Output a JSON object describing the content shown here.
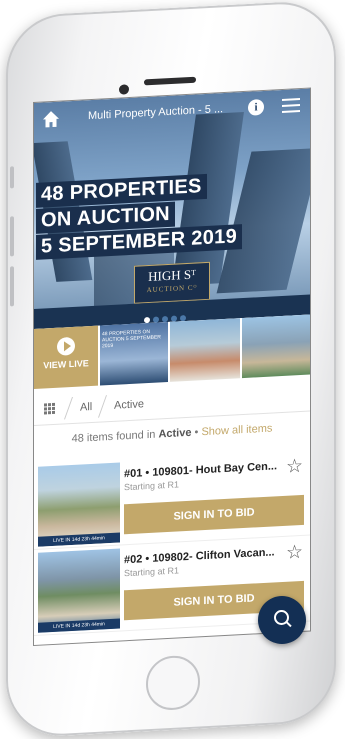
{
  "header": {
    "title": "Multi Property Auction - 5 ...",
    "info_icon": "i"
  },
  "hero": {
    "line1": "48 PROPERTIES",
    "line2": "ON AUCTION",
    "line3": "5 SEPTEMBER 2019",
    "logo_top": "THE",
    "logo_main": "HIGH Sᵀ",
    "logo_bottom": "AUCTION Cᴼ"
  },
  "carousel": {
    "view_live_label": "VIEW LIVE",
    "thumb1_text": "48 PROPERTIES ON AUCTION 5 SEPTEMBER 2019"
  },
  "filters": {
    "tab_all": "All",
    "tab_active": "Active"
  },
  "results": {
    "count_text": "48 items found in",
    "status": "Active",
    "separator": "•",
    "show_all": "Show all items"
  },
  "lots": [
    {
      "name": "#01 • 109801- Hout Bay Cen...",
      "starting": "Starting at R1",
      "live_badge": "LIVE IN 14d 23h 44min",
      "bid_label": "SIGN IN TO BID"
    },
    {
      "name": "#02 • 109802- Clifton Vacan...",
      "starting": "Starting at R1",
      "live_badge": "LIVE IN 14d 23h 44min",
      "bid_label": "SIGN IN TO BID"
    }
  ],
  "colors": {
    "navy": "#1a2f4d",
    "gold": "#c3a86a"
  }
}
